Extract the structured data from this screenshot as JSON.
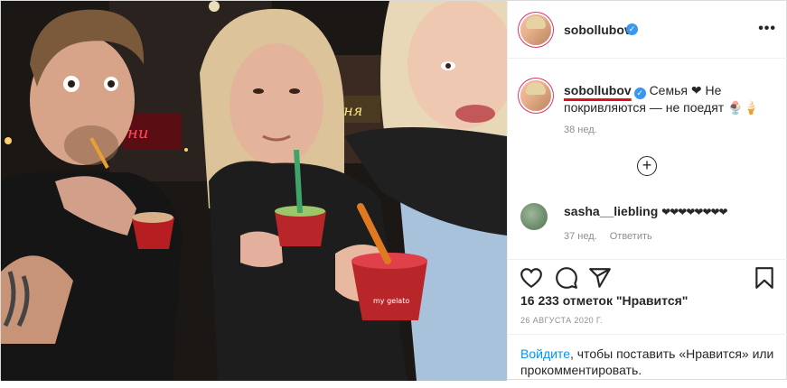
{
  "post": {
    "username": "sobollubov",
    "verified_icon": "verified-badge-icon",
    "more_icon": "more-options-icon",
    "more_label": "•••"
  },
  "caption": {
    "username": "sobollubov",
    "text_part1": "Семья",
    "heart": "❤",
    "text_part2": "Не покривляются — не поедят",
    "emoji_tail": "🍨🍦",
    "time": "38 нед.",
    "load_more_icon": "plus-circle-icon",
    "load_more_label": "+"
  },
  "comment": {
    "username": "sasha__liebling",
    "text": "❤❤❤❤❤❤❤❤",
    "time": "37 нед.",
    "reply": "Ответить"
  },
  "actions": {
    "likes": "16 233 отметок \"Нравится\"",
    "date": "26 АВГУСТА 2020 Г.",
    "login_link": "Войдите",
    "login_text": ", чтобы поставить «Нравится» или прокомментировать."
  },
  "colors": {
    "link": "#0095f6",
    "verified": "#3897f0",
    "annotation_underline": "#e0101b",
    "muted": "#8e8e8e"
  }
}
